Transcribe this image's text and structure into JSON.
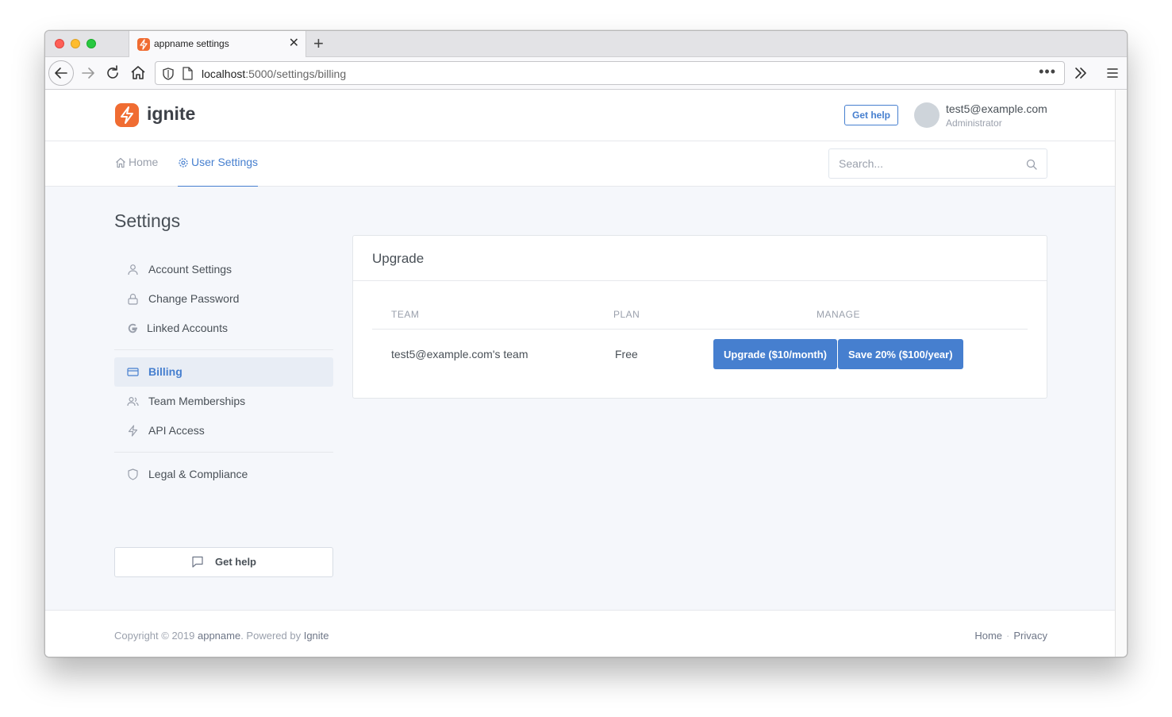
{
  "browser": {
    "tab_title": "appname settings",
    "url_host": "localhost",
    "url_path": ":5000/settings/billing",
    "close_glyph": "✕",
    "new_tab_glyph": "+",
    "more_glyph": "•••"
  },
  "header": {
    "logo_text": "ignite",
    "get_help_label": "Get help",
    "user_email": "test5@example.com",
    "user_role": "Administrator"
  },
  "subnav": {
    "home_label": "Home",
    "settings_label": "User Settings",
    "search_placeholder": "Search..."
  },
  "sidebar": {
    "title": "Settings",
    "items": [
      {
        "label": "Account Settings",
        "icon": "user-icon"
      },
      {
        "label": "Change Password",
        "icon": "lock-icon"
      },
      {
        "label": "Linked Accounts",
        "icon": "google-icon"
      },
      {
        "label": "Billing",
        "icon": "credit-card-icon",
        "active": true
      },
      {
        "label": "Team Memberships",
        "icon": "users-icon"
      },
      {
        "label": "API Access",
        "icon": "zap-icon"
      },
      {
        "label": "Legal & Compliance",
        "icon": "shield-icon"
      }
    ],
    "get_help_label": "Get help"
  },
  "card": {
    "title": "Upgrade",
    "columns": [
      "TEAM",
      "PLAN",
      "MANAGE"
    ],
    "row": {
      "team": "test5@example.com's team",
      "plan": "Free",
      "upgrade_monthly_label": "Upgrade ($10/month)",
      "upgrade_yearly_label": "Save 20% ($100/year)"
    }
  },
  "footer": {
    "copyright": "Copyright © 2019",
    "app_name": "appname",
    "powered_by": ". Powered by",
    "powered_name": "Ignite",
    "links": [
      "Home",
      "Privacy"
    ],
    "separator": "·"
  },
  "colors": {
    "accent": "#467fcf",
    "brand": "#f06c32"
  }
}
